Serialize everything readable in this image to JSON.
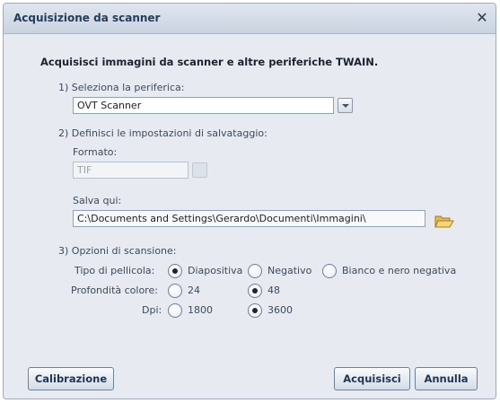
{
  "window": {
    "title": "Acquisizione da scanner",
    "close_glyph": "✕"
  },
  "heading": "Acquisisci immagini da scanner e altre periferiche TWAIN.",
  "device": {
    "label": "1) Seleziona la periferica:",
    "value": "OVT Scanner"
  },
  "save": {
    "label": "2) Definisci le impostazioni di salvataggio:",
    "format_label": "Formato:",
    "format_value": "TIF",
    "path_label": "Salva qui:",
    "path_value": "C:\\Documents and Settings\\Gerardo\\Documenti\\Immagini\\",
    "folder_icon": "folder-open-icon"
  },
  "scan": {
    "label": "3) Opzioni di scansione:",
    "film_type": {
      "label": "Tipo di pellicola:",
      "options": [
        {
          "label": "Diapositiva",
          "selected": true
        },
        {
          "label": "Negativo",
          "selected": false
        },
        {
          "label": "Bianco e nero negativa",
          "selected": false
        }
      ]
    },
    "color_depth": {
      "label": "Profondità colore:",
      "options": [
        {
          "label": "24",
          "selected": false
        },
        {
          "label": "48",
          "selected": true
        }
      ]
    },
    "dpi": {
      "label": "Dpi:",
      "options": [
        {
          "label": "1800",
          "selected": false
        },
        {
          "label": "3600",
          "selected": true
        }
      ]
    }
  },
  "buttons": {
    "calibrate": "Calibrazione",
    "acquire": "Acquisisci",
    "cancel": "Annulla"
  },
  "colors": {
    "title_text": "#243c5e",
    "dialog_bg": "#e7ebf1",
    "button_text": "#1f3555"
  }
}
